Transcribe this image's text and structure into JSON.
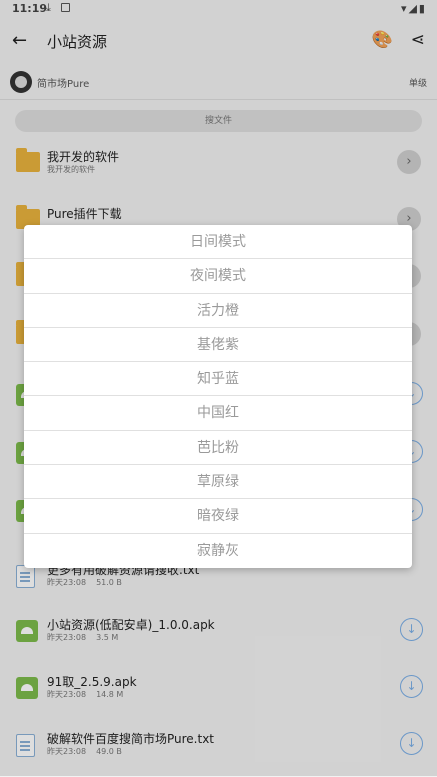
{
  "status": {
    "time": "11:19",
    "dl_glyph": "⤓",
    "right_glyphs": "▾◢▮"
  },
  "appbar": {
    "title": "小站资源",
    "back_glyph": "←",
    "palette_glyph": "🎨",
    "share_glyph": "⋖"
  },
  "user": {
    "name": "简市场Pure",
    "sort": "单级"
  },
  "search": {
    "placeholder": "搜文件"
  },
  "files": [
    {
      "name": "我开发的软件",
      "sub": "我开发的软件",
      "type": "folder"
    },
    {
      "name": "Pure插件下载",
      "type": "folder"
    },
    {
      "name": "",
      "type": "folder"
    },
    {
      "name": "",
      "type": "folder"
    },
    {
      "name": "",
      "type": "apk"
    },
    {
      "name": "",
      "type": "apk"
    },
    {
      "name": "",
      "type": "apk"
    },
    {
      "name": "更多有用破解资源请搜收.txt",
      "date": "昨天23:08",
      "size": "51.0 B",
      "type": "txt"
    },
    {
      "name": "小站资源(低配安卓)_1.0.0.apk",
      "date": "昨天23:08",
      "size": "3.5 M",
      "type": "apk"
    },
    {
      "name": "91取_2.5.9.apk",
      "date": "昨天23:08",
      "size": "14.8 M",
      "type": "apk"
    },
    {
      "name": "破解软件百度搜简市场Pure.txt",
      "date": "昨天23:08",
      "size": "49.0 B",
      "type": "txt"
    }
  ],
  "glyphs": {
    "chevron": "›",
    "download": "↓"
  },
  "theme_dialog": {
    "options": [
      "日间模式",
      "夜间模式",
      "活力橙",
      "基佬紫",
      "知乎蓝",
      "中国红",
      "芭比粉",
      "草原绿",
      "暗夜绿",
      "寂静灰"
    ]
  },
  "colors": {
    "folder": "#e9b33d",
    "apk": "#7dbb4b",
    "download_accent": "#7aaee6"
  }
}
